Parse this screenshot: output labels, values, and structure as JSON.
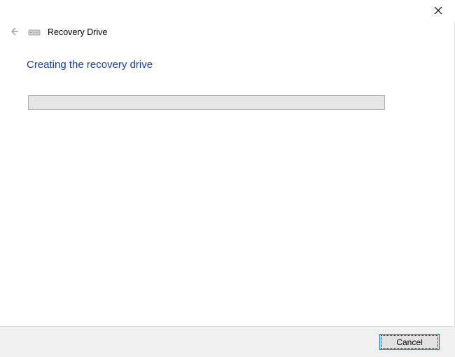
{
  "titlebar": {
    "close_label": "Close"
  },
  "header": {
    "back_label": "Back",
    "title": "Recovery Drive"
  },
  "main": {
    "heading": "Creating the recovery drive",
    "progress_percent": 0
  },
  "footer": {
    "cancel_label": "Cancel"
  },
  "icons": {
    "close": "close-icon",
    "back": "back-arrow-icon",
    "drive": "drive-icon"
  }
}
